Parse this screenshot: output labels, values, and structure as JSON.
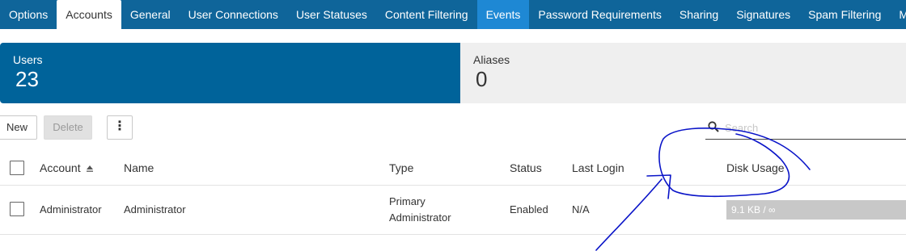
{
  "tabs": [
    {
      "label": "Options",
      "state": "normal"
    },
    {
      "label": "Accounts",
      "state": "active"
    },
    {
      "label": "General",
      "state": "normal"
    },
    {
      "label": "User Connections",
      "state": "normal"
    },
    {
      "label": "User Statuses",
      "state": "normal"
    },
    {
      "label": "Content Filtering",
      "state": "normal"
    },
    {
      "label": "Events",
      "state": "highlight"
    },
    {
      "label": "Password Requirements",
      "state": "normal"
    },
    {
      "label": "Sharing",
      "state": "normal"
    },
    {
      "label": "Signatures",
      "state": "normal"
    },
    {
      "label": "Spam Filtering",
      "state": "normal"
    },
    {
      "label": "More",
      "state": "normal"
    }
  ],
  "cards": {
    "users": {
      "title": "Users",
      "count": "23"
    },
    "aliases": {
      "title": "Aliases",
      "count": "0"
    }
  },
  "toolbar": {
    "new_label": "New",
    "delete_label": "Delete",
    "more_label": "⋮"
  },
  "search": {
    "placeholder": "Search",
    "value": ""
  },
  "table": {
    "headers": {
      "account": "Account",
      "name": "Name",
      "type": "Type",
      "status": "Status",
      "last_login": "Last Login",
      "disk_usage": "Disk Usage"
    },
    "sort_column": "account",
    "sort_direction": "ascending",
    "rows": [
      {
        "account": "Administrator",
        "name": "Administrator",
        "type_line1": "Primary",
        "type_line2": "Administrator",
        "status": "Enabled",
        "last_login": "N/A",
        "disk_usage": "9.1 KB / ∞"
      }
    ]
  },
  "colors": {
    "tab_bar": "#0f659a",
    "tab_highlight": "#1e88d4",
    "users_card": "#00639a",
    "aliases_card": "#efefef",
    "usage_bar": "#c8c8c8",
    "annotation_ink": "#0a14c8"
  },
  "icons": {
    "search": "search-icon",
    "sort": "sort-ascending-icon",
    "more": "vertical-ellipsis-icon"
  }
}
